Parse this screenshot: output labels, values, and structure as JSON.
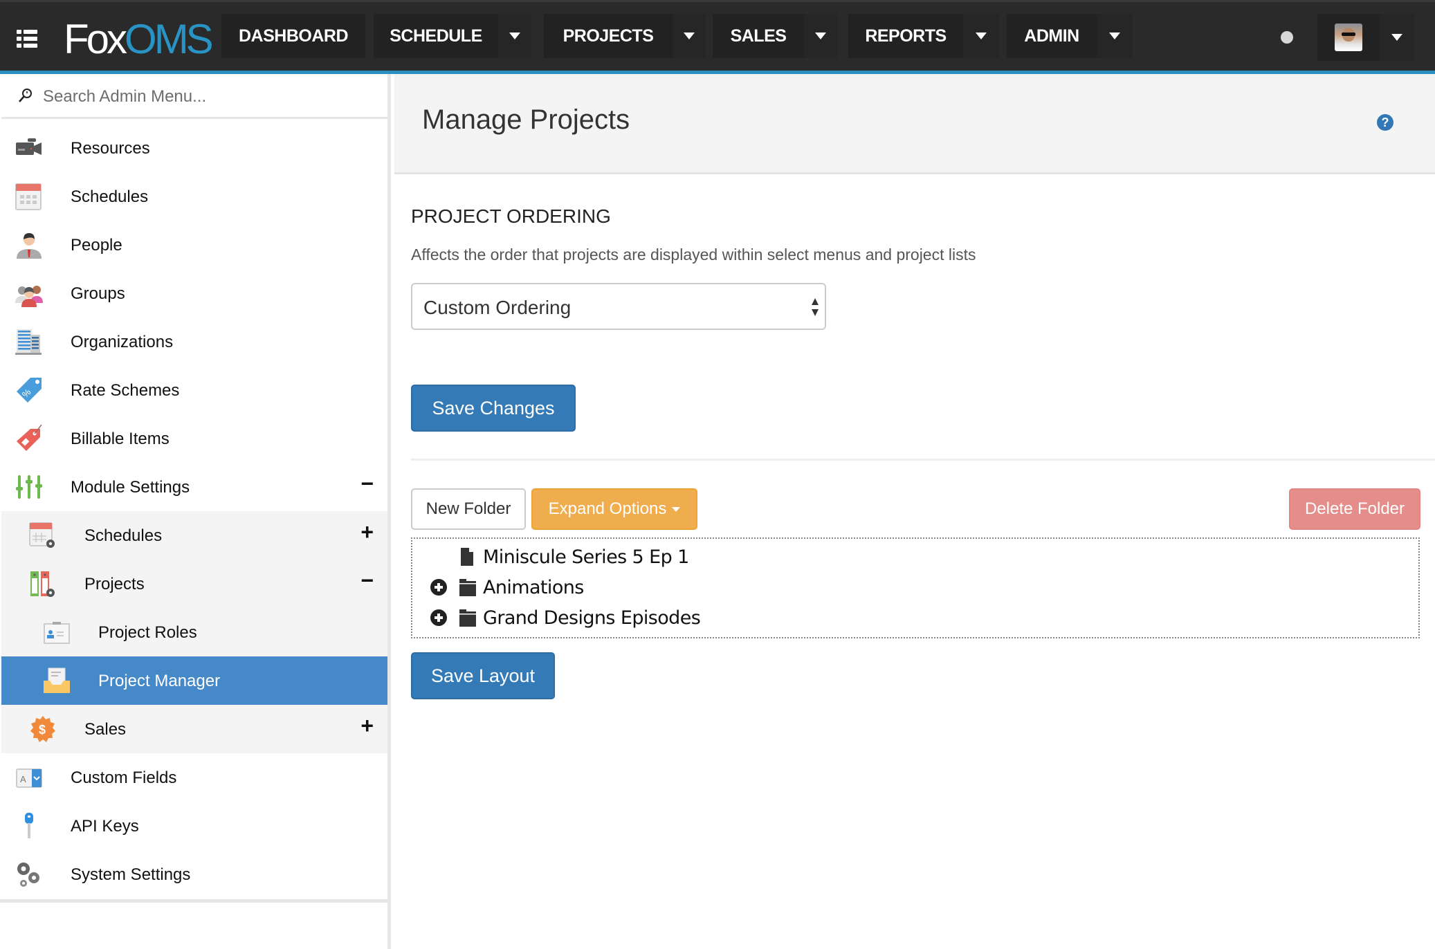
{
  "navbar": {
    "logo_part1": "Fox",
    "logo_part2": "OMS",
    "items": [
      {
        "label": "DASHBOARD",
        "has_dropdown": false
      },
      {
        "label": "SCHEDULE",
        "has_dropdown": true
      },
      {
        "label": "PROJECTS",
        "has_dropdown": true
      },
      {
        "label": "SALES",
        "has_dropdown": true
      },
      {
        "label": "REPORTS",
        "has_dropdown": true
      },
      {
        "label": "ADMIN",
        "has_dropdown": true
      }
    ],
    "accent_color": "#2a93c6"
  },
  "sidebar": {
    "search_placeholder": "Search Admin Menu...",
    "items": [
      {
        "label": "Resources",
        "icon": "video-camera-icon"
      },
      {
        "label": "Schedules",
        "icon": "calendar-icon"
      },
      {
        "label": "People",
        "icon": "person-icon"
      },
      {
        "label": "Groups",
        "icon": "group-icon"
      },
      {
        "label": "Organizations",
        "icon": "building-icon"
      },
      {
        "label": "Rate Schemes",
        "icon": "percent-tag-icon"
      },
      {
        "label": "Billable Items",
        "icon": "price-tag-icon"
      },
      {
        "label": "Module Settings",
        "icon": "sliders-icon",
        "toggle": "−"
      },
      {
        "label": "Schedules",
        "icon": "calendar-settings-icon",
        "toggle": "+"
      },
      {
        "label": "Projects",
        "icon": "binders-settings-icon",
        "toggle": "−"
      },
      {
        "label": "Project Roles",
        "icon": "id-card-icon"
      },
      {
        "label": "Project Manager",
        "icon": "inbox-document-icon",
        "active": true
      },
      {
        "label": "Sales",
        "icon": "dollar-badge-icon",
        "toggle": "+"
      },
      {
        "label": "Custom Fields",
        "icon": "dropdown-field-icon"
      },
      {
        "label": "API Keys",
        "icon": "key-icon"
      },
      {
        "label": "System Settings",
        "icon": "gears-icon"
      }
    ],
    "active_color": "#4689c8"
  },
  "main": {
    "page_title": "Manage Projects",
    "help_glyph": "?",
    "ordering": {
      "title": "PROJECT ORDERING",
      "description": "Affects the order that projects are displayed within select menus and project lists",
      "selected_value": "Custom Ordering",
      "save_label": "Save Changes"
    },
    "folder_toolbar": {
      "new_folder_label": "New Folder",
      "expand_options_label": "Expand Options",
      "delete_folder_label": "Delete Folder"
    },
    "tree": [
      {
        "label": "Miniscule Series 5 Ep 1",
        "type": "file",
        "expandable": false
      },
      {
        "label": "Animations",
        "type": "folder",
        "expandable": true
      },
      {
        "label": "Grand Designs Episodes",
        "type": "folder",
        "expandable": true
      }
    ],
    "save_layout_label": "Save Layout"
  }
}
